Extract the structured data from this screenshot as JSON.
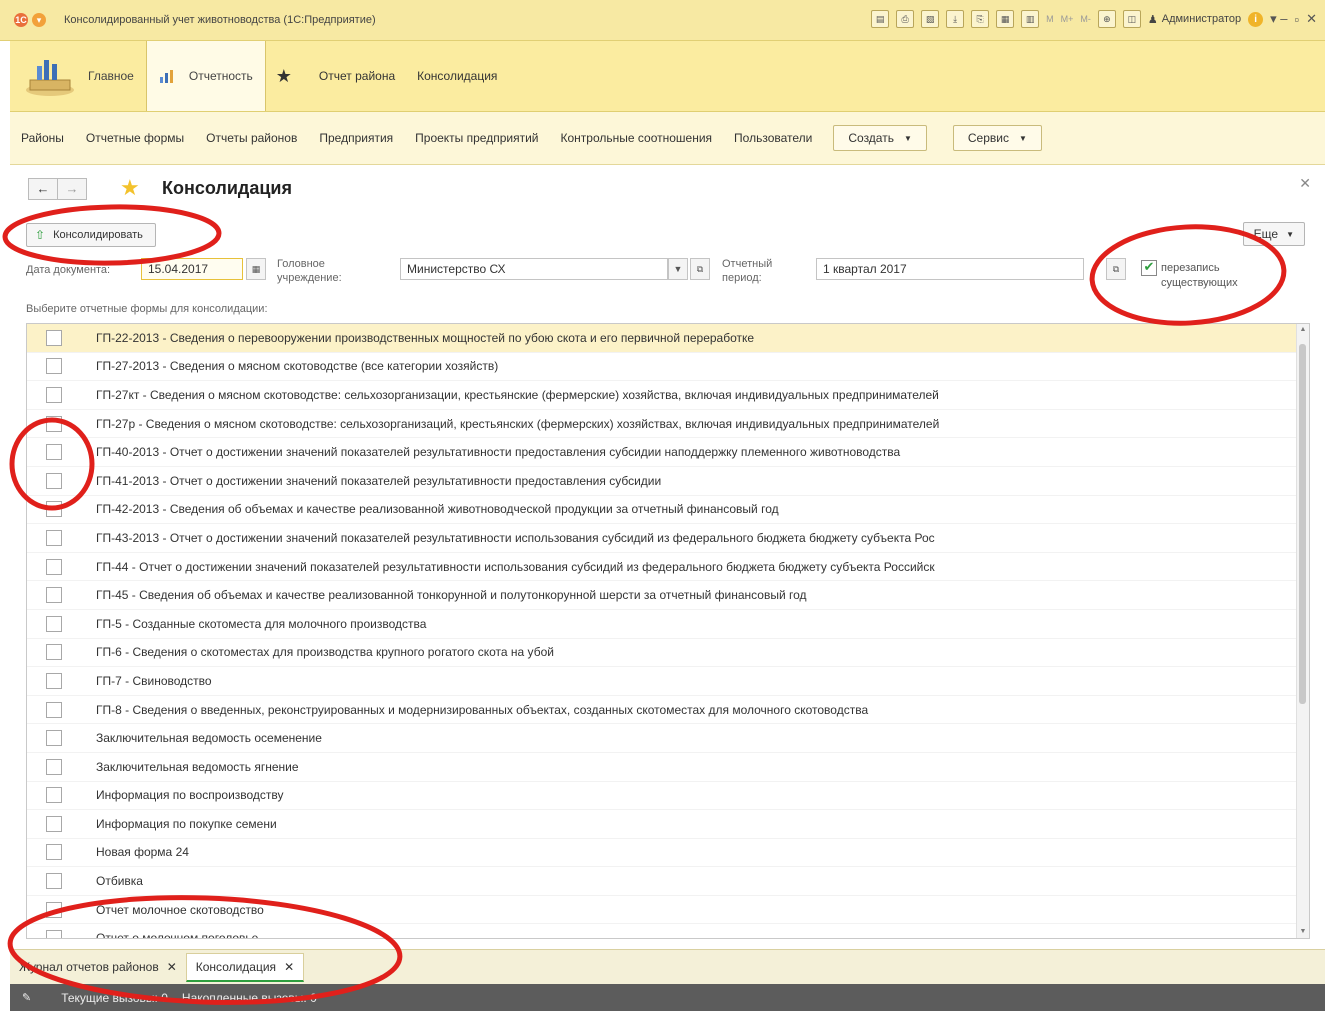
{
  "window": {
    "title": "Консолидированный учет животноводства (1С:Предприятие)",
    "toolbar_m_labels": [
      "M",
      "M+",
      "M-"
    ],
    "user": "Администратор"
  },
  "sections": {
    "items": [
      {
        "label": "Главное"
      },
      {
        "label": "Отчетность"
      },
      {
        "label": "Отчет района"
      },
      {
        "label": "Консолидация"
      }
    ]
  },
  "function_panel": {
    "links": [
      "Районы",
      "Отчетные формы",
      "Отчеты районов",
      "Предприятия",
      "Проекты предприятий",
      "Контрольные соотношения",
      "Пользователи"
    ],
    "create_label": "Создать",
    "service_label": "Сервис"
  },
  "form": {
    "title": "Консолидация",
    "consolidate_label": "Консолидировать",
    "more_label": "Еще",
    "date_label": "Дата документа:",
    "date_value": "15.04.2017",
    "org_label_1": "Головное",
    "org_label_2": "учреждение:",
    "org_value": "Министерство СХ",
    "period_label_1": "Отчетный",
    "period_label_2": "период:",
    "period_value": "1 квартал 2017",
    "overwrite_label_1": "перезапись",
    "overwrite_label_2": "существующих",
    "overwrite_checked": true,
    "list_label": "Выберите отчетные формы для консолидации:"
  },
  "report_forms": [
    {
      "label": "ГП-22-2013 - Сведения о перевооружении производственных мощностей по убою скота и его первичной переработке",
      "checked": false
    },
    {
      "label": "ГП-27-2013 - Сведения о мясном скотоводстве (все категории хозяйств)",
      "checked": false
    },
    {
      "label": "ГП-27кт - Сведения о мясном скотоводстве: сельхозорганизации, крестьянские (фермерские) хозяйства, включая индивидуальных предпринимателей",
      "checked": false
    },
    {
      "label": "ГП-27р - Сведения о мясном скотоводстве: сельхозорганизаций, крестьянских (фермерских) хозяйствах, включая индивидуальных предпринимателей",
      "checked": false
    },
    {
      "label": "ГП-40-2013 - Отчет о достижении значений показателей результативности предоставления субсидии наподдержку племенного животноводства",
      "checked": false
    },
    {
      "label": "ГП-41-2013 - Отчет о достижении значений показателей результативности предоставления субсидии",
      "checked": false
    },
    {
      "label": "ГП-42-2013 - Сведения об объемах и  качестве реализованной животноводческой продукции за отчетный финансовый год",
      "checked": false
    },
    {
      "label": "ГП-43-2013 - Отчет о достижении  значений показателей результативности использования субсидий из федерального бюджета бюджету субъекта Рос",
      "checked": false
    },
    {
      "label": "ГП-44 - Отчет о достижении  значений показателей результативности использования субсидий из федерального бюджета бюджету субъекта Российск",
      "checked": false
    },
    {
      "label": "ГП-45 - Сведения об объемах и качестве реализованной тонкорунной и полутонкорунной шерсти за отчетный финансовый год",
      "checked": false
    },
    {
      "label": "ГП-5 - Созданные скотоместа для молочного производства",
      "checked": false
    },
    {
      "label": "ГП-6 - Сведения о скотоместах для производства крупного рогатого скота на убой",
      "checked": false
    },
    {
      "label": "ГП-7 - Свиноводство",
      "checked": false
    },
    {
      "label": "ГП-8 - Сведения о введенных, реконструированных и модернизированных объектах, созданных скотоместах для молочного скотоводства",
      "checked": false
    },
    {
      "label": "Заключительная ведомость осеменение",
      "checked": false
    },
    {
      "label": "Заключительная ведомость ягнение",
      "checked": false
    },
    {
      "label": "Информация по воспроизводству",
      "checked": false
    },
    {
      "label": "Информация по покупке семени",
      "checked": false
    },
    {
      "label": "Новая форма 24",
      "checked": false
    },
    {
      "label": "Отбивка",
      "checked": false
    },
    {
      "label": "Отчет молочное скотоводство",
      "checked": false
    },
    {
      "label": "Отчет о молочном поголовье",
      "checked": false
    }
  ],
  "open_windows": [
    {
      "label": "Журнал отчетов районов"
    },
    {
      "label": "Консолидация"
    }
  ],
  "status": {
    "current_calls": "Текущие вызовы: 0",
    "accumulated_calls": "Накопленные вызовы: 0"
  },
  "colors": {
    "annotation": "#e0201b",
    "accent_green": "#2e9e3e",
    "section_panel": "#fbeca0",
    "selected_row": "#fcf2c8"
  }
}
